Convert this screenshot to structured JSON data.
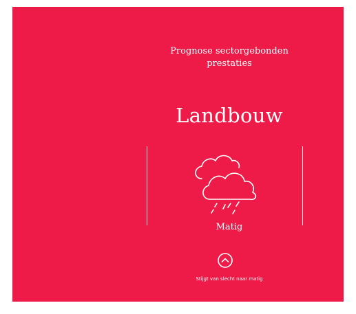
{
  "sector": {
    "subtitle": "Prognose sectorgebonden\nprestaties",
    "title": "Landbouw",
    "status": "Matig",
    "status_icon": "rain-cloud-icon",
    "trend_icon": "chevron-up-circle-icon",
    "trend_text": "Stijgt van slecht naar matig"
  },
  "colors": {
    "background": "#EE1A47",
    "foreground": "#FFFFFF"
  }
}
